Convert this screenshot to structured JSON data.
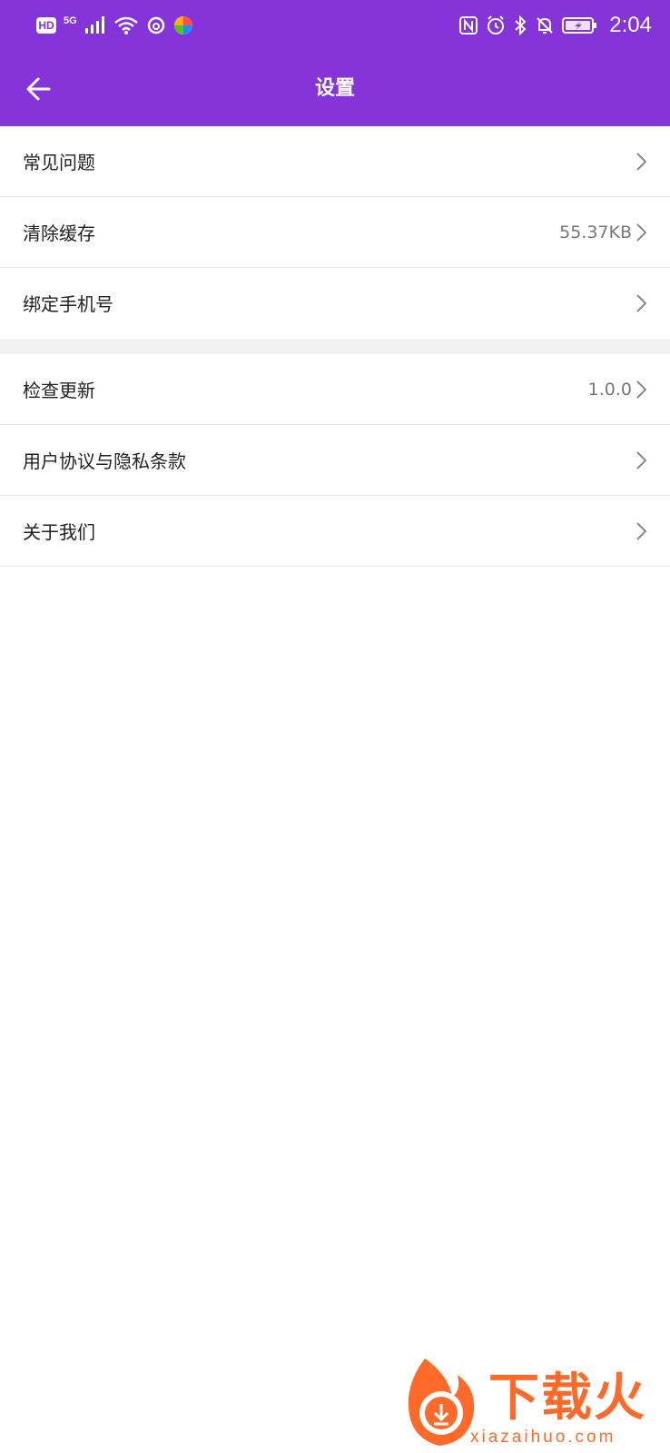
{
  "status_bar": {
    "network_type": "5G",
    "hd_badge": "HD",
    "time": "2:04"
  },
  "header": {
    "title": "设置",
    "back_icon": "arrow-left-icon"
  },
  "settings": {
    "group1": [
      {
        "label": "常见问题",
        "value": ""
      },
      {
        "label": "清除缓存",
        "value": "55.37KB"
      },
      {
        "label": "绑定手机号",
        "value": ""
      }
    ],
    "group2": [
      {
        "label": "检查更新",
        "value": "1.0.0"
      },
      {
        "label": "用户协议与隐私条款",
        "value": ""
      },
      {
        "label": "关于我们",
        "value": ""
      }
    ]
  },
  "watermark": {
    "title": "下载火",
    "url": "xiazaihuo.com"
  },
  "colors": {
    "accent": "#8434d8",
    "watermark": "#ff6a2a",
    "divider": "#f2f2f2"
  }
}
